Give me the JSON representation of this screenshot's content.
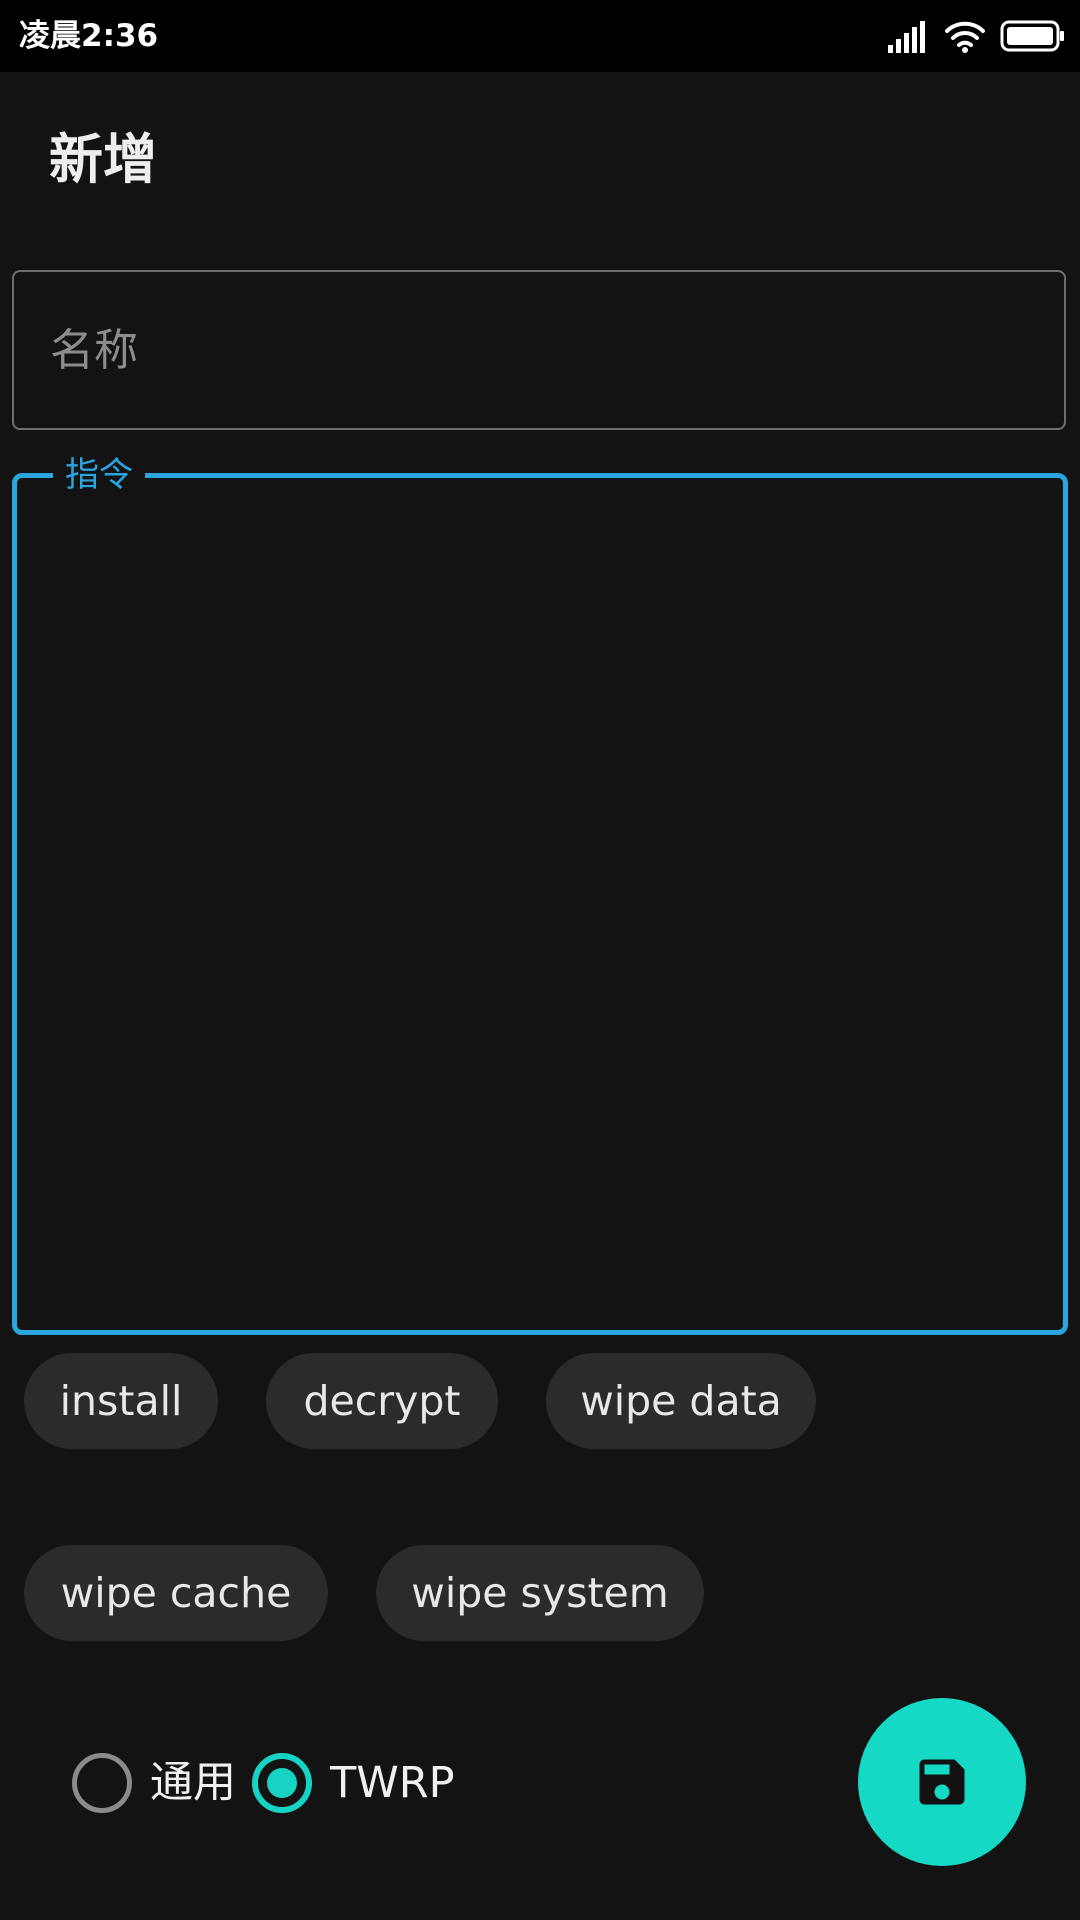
{
  "status_bar": {
    "time": "凌晨2:36",
    "icons": [
      "signal-icon",
      "wifi-icon",
      "battery-icon"
    ]
  },
  "header": {
    "title": "新增"
  },
  "form": {
    "name_field": {
      "placeholder": "名称",
      "value": ""
    },
    "command_field": {
      "label": "指令",
      "value": ""
    }
  },
  "command_chips": [
    "install",
    "decrypt",
    "wipe data",
    "wipe cache",
    "wipe system"
  ],
  "mode_options": [
    {
      "label": "通用",
      "selected": false
    },
    {
      "label": "TWRP",
      "selected": true
    }
  ],
  "fab": {
    "icon": "save-icon"
  },
  "colors": {
    "background": "#131313",
    "status_bar": "#000000",
    "accent_blue": "#29a5e0",
    "accent_teal": "#16d3c3",
    "chip_background": "#2b2b2b"
  }
}
